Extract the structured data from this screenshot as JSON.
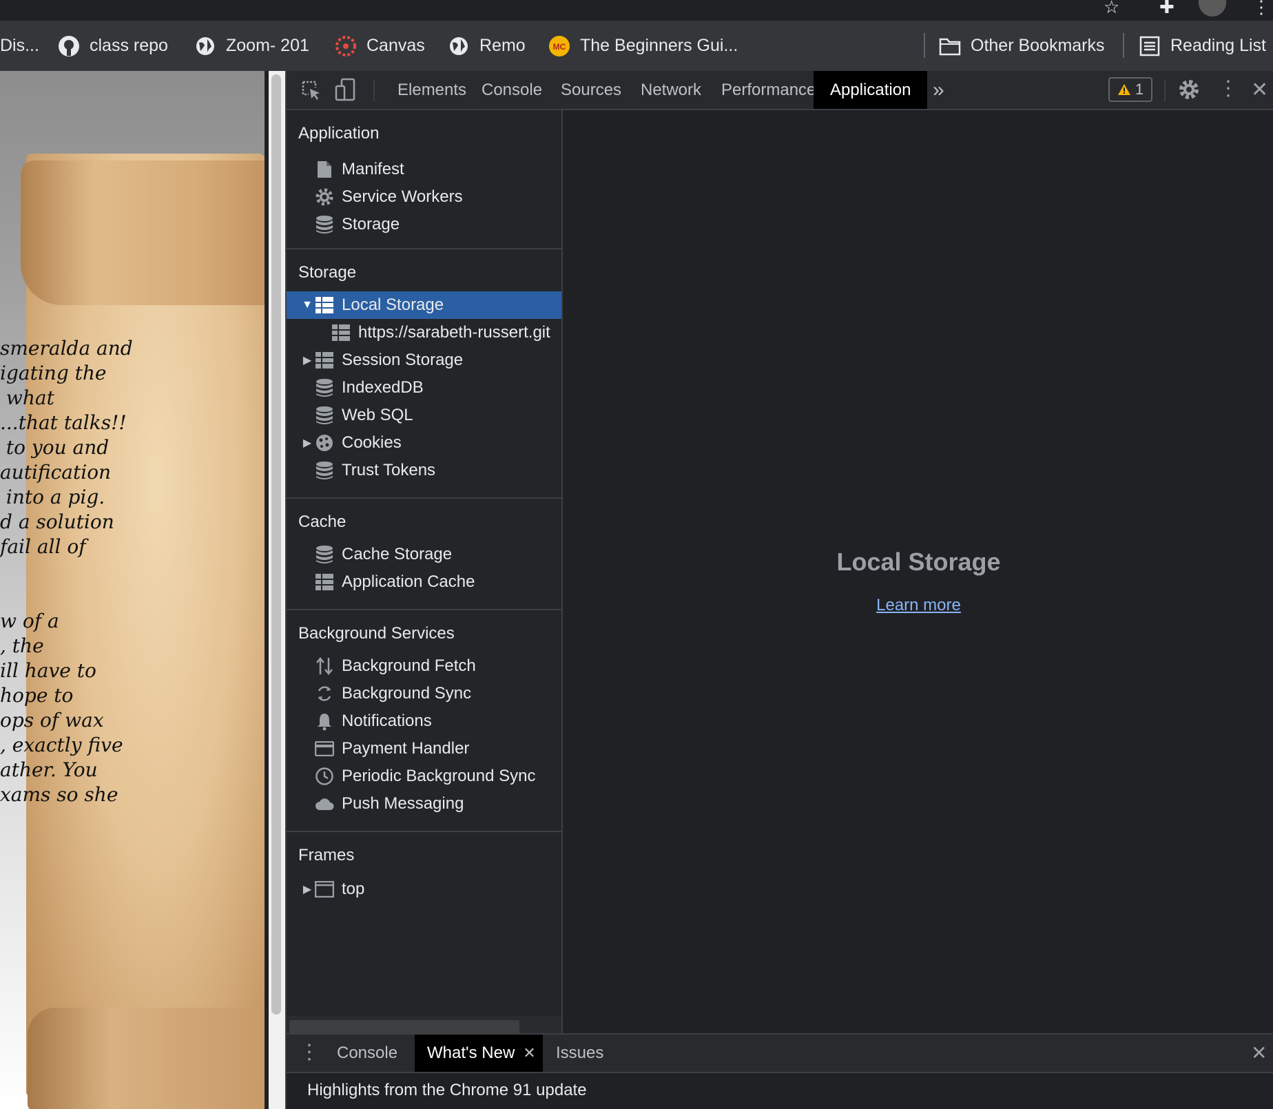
{
  "bookmarks": [
    {
      "label": "Dis...",
      "icon": "none"
    },
    {
      "label": "class repo",
      "icon": "github-icon"
    },
    {
      "label": "Zoom- 201",
      "icon": "globe-icon"
    },
    {
      "label": "Canvas",
      "icon": "canvas-icon"
    },
    {
      "label": "Remo",
      "icon": "globe-icon"
    },
    {
      "label": "The Beginners Gui...",
      "icon": "mc-icon"
    },
    {
      "label": "Other Bookmarks",
      "icon": "folder-icon"
    },
    {
      "label": "Reading List",
      "icon": "reading-list-icon"
    }
  ],
  "page": {
    "text_lines": [
      "smeralda and",
      "igating the",
      " what",
      "...that talks!!",
      " to you and",
      "autification",
      " into a pig.",
      "d a solution",
      "fail all of",
      "",
      "",
      "w of a",
      ", the",
      "ill have to",
      "hope to",
      "ops of wax",
      ", exactly five",
      "ather. You",
      "xams so she"
    ]
  },
  "devtools": {
    "tabs": [
      "Elements",
      "Console",
      "Sources",
      "Network",
      "Performance",
      "Application"
    ],
    "active_tab": "Application",
    "more_tabs": "»",
    "warning_count": "1",
    "sidebar": {
      "application": {
        "title": "Application",
        "items": [
          {
            "label": "Manifest",
            "icon": "file-icon"
          },
          {
            "label": "Service Workers",
            "icon": "gear-icon"
          },
          {
            "label": "Storage",
            "icon": "database-icon"
          }
        ]
      },
      "storage": {
        "title": "Storage",
        "items": [
          {
            "label": "Local Storage",
            "icon": "table-icon",
            "expanded": true,
            "selected": true
          },
          {
            "label": "https://sarabeth-russert.git",
            "icon": "table-icon"
          },
          {
            "label": "Session Storage",
            "icon": "table-icon",
            "expanded": false
          },
          {
            "label": "IndexedDB",
            "icon": "database-icon"
          },
          {
            "label": "Web SQL",
            "icon": "database-icon"
          },
          {
            "label": "Cookies",
            "icon": "cookie-icon",
            "expanded": false
          },
          {
            "label": "Trust Tokens",
            "icon": "database-icon"
          }
        ]
      },
      "cache": {
        "title": "Cache",
        "items": [
          {
            "label": "Cache Storage",
            "icon": "database-icon"
          },
          {
            "label": "Application Cache",
            "icon": "table-icon"
          }
        ]
      },
      "background": {
        "title": "Background Services",
        "items": [
          {
            "label": "Background Fetch",
            "icon": "updown-arrows-icon"
          },
          {
            "label": "Background Sync",
            "icon": "sync-icon"
          },
          {
            "label": "Notifications",
            "icon": "bell-icon"
          },
          {
            "label": "Payment Handler",
            "icon": "card-icon"
          },
          {
            "label": "Periodic Background Sync",
            "icon": "clock-icon"
          },
          {
            "label": "Push Messaging",
            "icon": "cloud-icon"
          }
        ]
      },
      "frames": {
        "title": "Frames",
        "items": [
          {
            "label": "top",
            "icon": "frame-icon",
            "expanded": false
          }
        ]
      }
    },
    "main": {
      "title": "Local Storage",
      "link": "Learn more"
    },
    "drawer": {
      "tabs": [
        "Console",
        "What's New",
        "Issues"
      ],
      "active_tab": "What's New",
      "content": "Highlights from the Chrome 91 update"
    }
  }
}
